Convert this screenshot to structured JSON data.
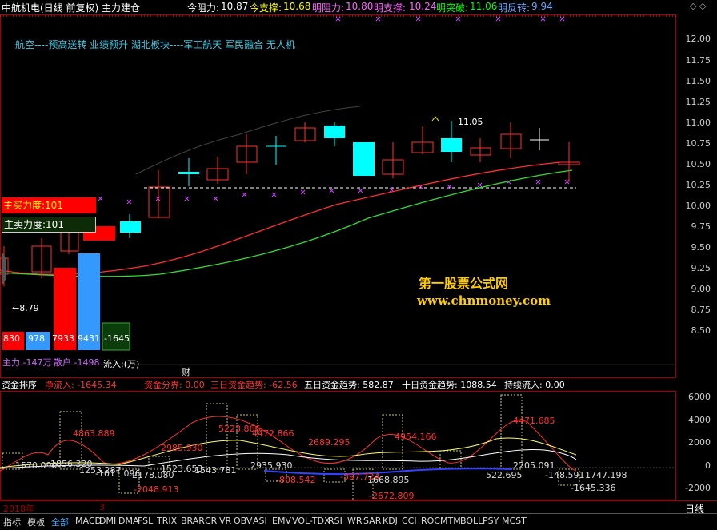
{
  "header": {
    "title": "中航机电(日线 前复权) 主力建仓",
    "today_resist_label": "今阻力:",
    "today_resist": "10.87",
    "today_support_label": "今支撑:",
    "today_support": "10.68",
    "tmr_resist_label": "明阻力:",
    "tmr_resist": "10.80",
    "tmr_support_label": "明支撑:",
    "tmr_support": "10.24",
    "tmr_break_label": "明突破:",
    "tmr_break": "11.06",
    "tmr_reverse_label": "明反转:",
    "tmr_reverse": "9.94",
    "colors": {
      "resist": "#ffffff",
      "support": "#ffff00",
      "purple": "#ff66ff",
      "green": "#00ff00",
      "reverse": "#66aaff"
    }
  },
  "concept": "航空----预高送转 业绩预升 湖北板块----军工航天 军民融合 无人机",
  "price_axis": [
    "12.00",
    "11.75",
    "11.50",
    "11.25",
    "11.00",
    "10.75",
    "10.50",
    "10.25",
    "10.00",
    "9.75",
    "9.50",
    "9.25",
    "9.00",
    "8.75",
    "8.50"
  ],
  "annotations": {
    "high": "11.05",
    "low": "8.79"
  },
  "force": {
    "buy_label": "主买力度:101",
    "sell_label": "主卖力度:101"
  },
  "bars": {
    "v1": "830",
    "v2": "978",
    "v3": "7933",
    "v4": "9431",
    "v5": "-1645"
  },
  "flow_line": {
    "main": "主力 -147万",
    "retail": "散户 -1498",
    "tail": "流入:(万)"
  },
  "cai_mark": "财",
  "watermark": {
    "name": "第一股票公式网",
    "url": "www.chnmoney.com"
  },
  "sub": {
    "title": "资金排序",
    "inflow": "净流入: -1645.34",
    "divide": "资金分界: 0.00",
    "trend3": "三日资金趋势: -62.56",
    "trend5": "五日资金趋势: 582.87",
    "trend10": "十日资金趋势: 1088.54",
    "cont": "持续流入: 0.00",
    "axis": [
      "6000",
      "4000",
      "2000",
      "0",
      "-2000"
    ],
    "labels": [
      "1570.090",
      "1856.320",
      "1253.287",
      "-1011.096",
      "-2048.913",
      "-2178.080",
      "1523.653",
      "1543.781",
      "2985.930",
      "4863.889",
      "5223.866",
      "4472.866",
      "2935.930",
      "2689.295",
      "4954.166",
      "1668.895",
      "-2672.809",
      "4471.685",
      "2205.091",
      "-148.591",
      "1747.198",
      "-1645.336",
      "-808.542",
      "-397.724",
      "522.695"
    ]
  },
  "bottom": {
    "year": "2018年",
    "month": "3",
    "period": "日线",
    "tabs": [
      "指标",
      "模板",
      "全部",
      "MACD",
      "DMI",
      "DMA",
      "FSL",
      "TRIX",
      "BRAR",
      "CR",
      "VR",
      "OBV",
      "ASI",
      "EMV",
      "VOL-TDX",
      "RSI",
      "WR",
      "SAR",
      "KDJ",
      "CCI",
      "ROC",
      "MTM",
      "BOLL",
      "PSY",
      "MCST"
    ]
  }
}
